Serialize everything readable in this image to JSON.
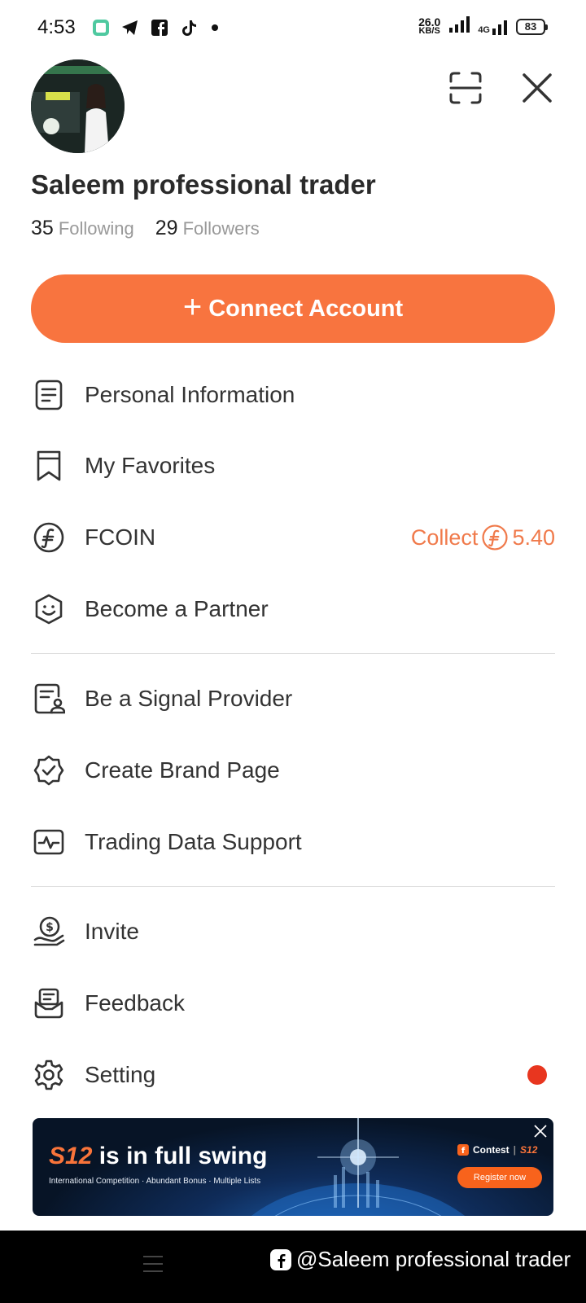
{
  "status_bar": {
    "time": "4:53",
    "speed_value": "26.0",
    "speed_unit": "KB/S",
    "network": "4G",
    "battery": "83"
  },
  "profile": {
    "name": "Saleem professional trader",
    "following_count": "35",
    "following_label": "Following",
    "followers_count": "29",
    "followers_label": "Followers"
  },
  "connect_button": {
    "plus": "+",
    "label": "Connect Account"
  },
  "menu": {
    "personal_info": "Personal Information",
    "favorites": "My Favorites",
    "fcoin": "FCOIN",
    "fcoin_collect": "Collect",
    "fcoin_value": "5.40",
    "partner": "Become a Partner",
    "signal_provider": "Be a Signal Provider",
    "brand_page": "Create Brand Page",
    "trading_data": "Trading Data Support",
    "invite": "Invite",
    "feedback": "Feedback",
    "setting": "Setting"
  },
  "banner": {
    "brand": "S12",
    "title_rest": " is in full swing",
    "subtitle": "International Competition · Abundant Bonus · Multiple Lists",
    "contest_label": "Contest",
    "contest_brand": "S12",
    "register_label": "Register now"
  },
  "watermark": {
    "text": "@Saleem professional trader"
  },
  "colors": {
    "accent": "#f8743f",
    "collect": "#f07a4b",
    "notification_dot": "#e8361f"
  }
}
